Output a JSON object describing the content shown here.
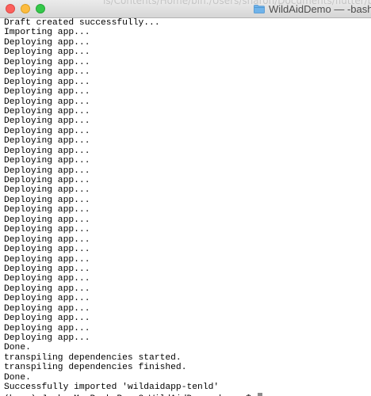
{
  "window": {
    "title": "WildAidDemo — -bash — ",
    "background_text": "ls/Contents/Home/bin:/Users/sharon/Documents/flutter/bin:/Users/sharon/Library/Android/sdk/platform-tools",
    "folder_icon": "folder-icon"
  },
  "terminal": {
    "lines": [
      "Draft created successfully...",
      "Importing app...",
      "Deploying app...",
      "Deploying app...",
      "Deploying app...",
      "Deploying app...",
      "Deploying app...",
      "Deploying app...",
      "Deploying app...",
      "Deploying app...",
      "Deploying app...",
      "Deploying app...",
      "Deploying app...",
      "Deploying app...",
      "Deploying app...",
      "Deploying app...",
      "Deploying app...",
      "Deploying app...",
      "Deploying app...",
      "Deploying app...",
      "Deploying app...",
      "Deploying app...",
      "Deploying app...",
      "Deploying app...",
      "Deploying app...",
      "Deploying app...",
      "Deploying app...",
      "Deploying app...",
      "Deploying app...",
      "Deploying app...",
      "Deploying app...",
      "Deploying app...",
      "Deploying app...",
      "Done.",
      "transpiling dependencies started.",
      "transpiling dependencies finished.",
      "Done.",
      "Successfully imported 'wildaidapp-tenld'"
    ],
    "prompt": "(base) Jacks-MacBook-Pro-2:WildAidDemo sharon$ "
  }
}
